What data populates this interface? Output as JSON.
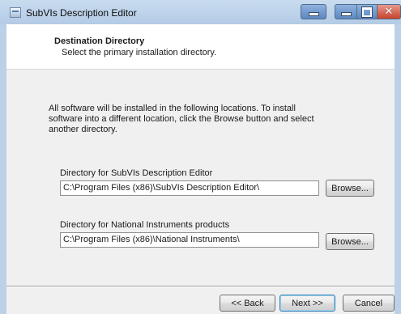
{
  "window": {
    "title": "SubVIs Description Editor"
  },
  "header": {
    "title": "Destination Directory",
    "subtitle": "Select the primary installation directory."
  },
  "body": {
    "intro": "All software will be installed in the following locations. To install software into a different location, click the Browse button and select another directory."
  },
  "directories": [
    {
      "label": "Directory for SubVIs Description Editor",
      "value": "C:\\Program Files (x86)\\SubVIs Description Editor\\",
      "browse_label": "Browse..."
    },
    {
      "label": "Directory for National Instruments products",
      "value": "C:\\Program Files (x86)\\National Instruments\\",
      "browse_label": "Browse..."
    }
  ],
  "footer": {
    "back_label": "<< Back",
    "next_label": "Next >>",
    "cancel_label": "Cancel"
  },
  "icons": {
    "app": "app-icon",
    "minimize": "minimize-icon",
    "maximize": "maximize-icon",
    "close": "close-icon"
  },
  "colors": {
    "titlebar": "#b9cfe8",
    "dialog_bg": "#f0f0f0",
    "header_bg": "#ffffff",
    "close_button": "#c7432d"
  }
}
